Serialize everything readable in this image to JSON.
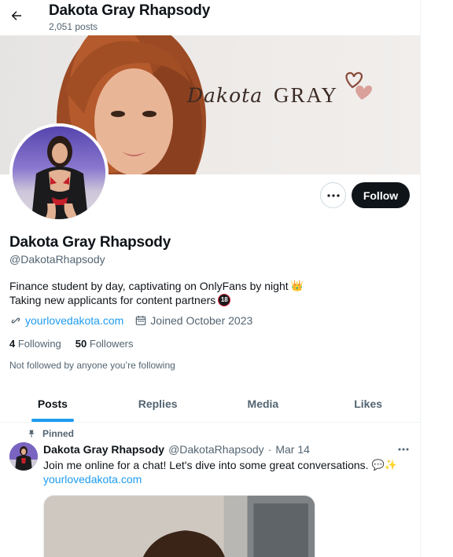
{
  "header": {
    "title": "Dakota Gray Rhapsody",
    "post_count": "2,051 posts"
  },
  "banner": {
    "script_text": "Dakota",
    "block_text": "GRAY"
  },
  "actions": {
    "follow_label": "Follow"
  },
  "profile": {
    "name": "Dakota Gray Rhapsody",
    "handle": "@DakotaRhapsody",
    "bio_line1": "Finance student by day, captivating on OnlyFans by night",
    "bio_line1_emoji": "👑",
    "bio_line2": "Taking new applicants for content partners",
    "bio_line2_emoji": "18",
    "website": "yourlovedakota.com",
    "joined": "Joined October 2023",
    "following_count": "4",
    "following_label": "Following",
    "followers_count": "50",
    "followers_label": "Followers",
    "not_followed": "Not followed by anyone you’re following"
  },
  "tabs": [
    {
      "label": "Posts",
      "active": true
    },
    {
      "label": "Replies",
      "active": false
    },
    {
      "label": "Media",
      "active": false
    },
    {
      "label": "Likes",
      "active": false
    }
  ],
  "post": {
    "pinned_label": "Pinned",
    "author_name": "Dakota Gray Rhapsody",
    "author_handle": "@DakotaRhapsody",
    "separator": "·",
    "date": "Mar 14",
    "text": "Join me online for a chat! Let's dive into some great conversations.",
    "text_emoji": "💬✨",
    "link": "yourlovedakota.com"
  },
  "colors": {
    "accent": "#1d9bf0",
    "text_primary": "#0f1419",
    "text_secondary": "#536471"
  }
}
